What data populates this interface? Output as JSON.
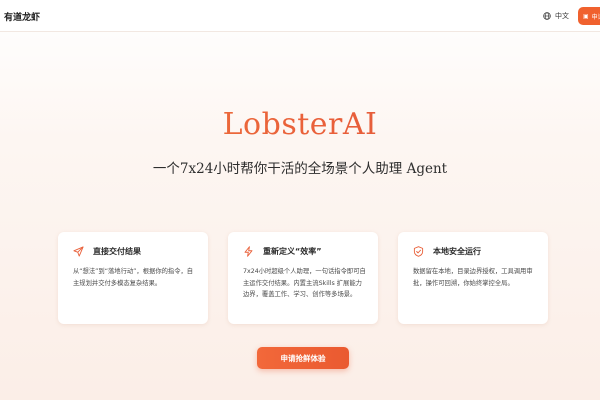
{
  "header": {
    "brand_name": "有道龙虾",
    "language_label": "中文",
    "language_icon": "globe-icon",
    "apply_button_label": "申请",
    "apply_button_icon": "ticket-icon"
  },
  "hero": {
    "title": "LobsterAI",
    "subtitle": "一个7x24小时帮你干活的全场景个人助理 Agent"
  },
  "features": [
    {
      "icon": "send-icon",
      "title": "直接交付结果",
      "description": "从“想法”到“落地行动”，根据你的指令，自主规划并交付多模态复杂结果。"
    },
    {
      "icon": "lightning-icon",
      "title": "重新定义“效率”",
      "description": "7x24小时超级个人助理，一句话指令即可自主运作交付结果。内置主流Skills 扩展能力边界，覆盖工作、学习、创作等多场景。"
    },
    {
      "icon": "shield-icon",
      "title": "本地安全运行",
      "description": "数据留在本地，目录边界授权，工具调用审批，操作可回溯，你始终掌控全局。"
    }
  ],
  "cta": {
    "label": "申请抢鲜体验"
  },
  "colors": {
    "accent": "#f0612e",
    "title_gradient_start": "#f07a3a",
    "title_gradient_end": "#d9553b"
  }
}
